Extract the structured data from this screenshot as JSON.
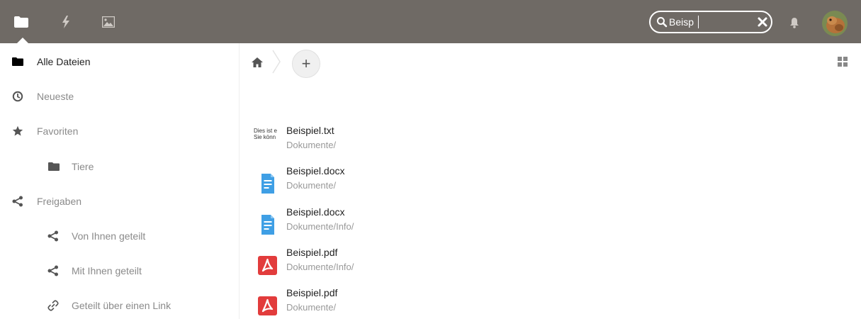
{
  "header": {
    "apps": [
      {
        "name": "files-app",
        "icon": "folder-icon",
        "active": true
      },
      {
        "name": "activity-app",
        "icon": "lightning-icon",
        "active": false
      },
      {
        "name": "gallery-app",
        "icon": "image-icon",
        "active": false
      }
    ],
    "search": {
      "value": "Beisp",
      "placeholder": ""
    },
    "accent": "#6f6a65"
  },
  "sidebar": {
    "items": [
      {
        "label": "Alle Dateien",
        "icon": "folder-icon",
        "active": true
      },
      {
        "label": "Neueste",
        "icon": "clock-icon"
      },
      {
        "label": "Favoriten",
        "icon": "star-icon"
      },
      {
        "label": "Tiere",
        "icon": "folder-icon"
      },
      {
        "label": "Freigaben",
        "icon": "share-icon"
      },
      {
        "label": "Von Ihnen geteilt",
        "icon": "share-icon"
      },
      {
        "label": "Mit Ihnen geteilt",
        "icon": "share-icon"
      },
      {
        "label": "Geteilt über einen Link",
        "icon": "link-icon"
      }
    ]
  },
  "main": {
    "add_label": "+",
    "txt_preview": [
      "Dies ist e",
      "Sie könn"
    ],
    "results": [
      {
        "name": "Beispiel.txt",
        "path": "Dokumente/",
        "type": "txt"
      },
      {
        "name": "Beispiel.docx",
        "path": "Dokumente/",
        "type": "docx"
      },
      {
        "name": "Beispiel.docx",
        "path": "Dokumente/Info/",
        "type": "docx"
      },
      {
        "name": "Beispiel.pdf",
        "path": "Dokumente/Info/",
        "type": "pdf"
      },
      {
        "name": "Beispiel.pdf",
        "path": "Dokumente/",
        "type": "pdf"
      }
    ]
  }
}
